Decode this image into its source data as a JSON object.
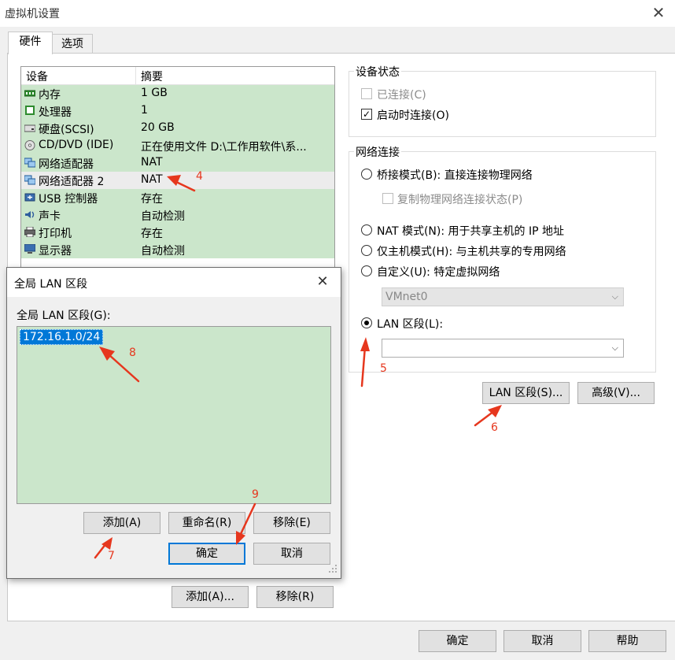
{
  "window": {
    "title": "虚拟机设置",
    "close_icon": "✕"
  },
  "tabs": [
    {
      "label": "硬件"
    },
    {
      "label": "选项"
    }
  ],
  "device_list": {
    "headers": {
      "device": "设备",
      "summary": "摘要"
    },
    "rows": [
      {
        "name": "内存",
        "summary": "1 GB",
        "icon": "memory-icon"
      },
      {
        "name": "处理器",
        "summary": "1",
        "icon": "processor-icon"
      },
      {
        "name": "硬盘(SCSI)",
        "summary": "20 GB",
        "icon": "hard-disk-icon"
      },
      {
        "name": "CD/DVD (IDE)",
        "summary": "正在使用文件 D:\\工作用软件\\系...",
        "icon": "cd-dvd-icon"
      },
      {
        "name": "网络适配器",
        "summary": "NAT",
        "icon": "network-adapter-icon"
      },
      {
        "name": "网络适配器 2",
        "summary": "NAT",
        "icon": "network-adapter-icon"
      },
      {
        "name": "USB 控制器",
        "summary": "存在",
        "icon": "usb-icon"
      },
      {
        "name": "声卡",
        "summary": "自动检测",
        "icon": "sound-card-icon"
      },
      {
        "name": "打印机",
        "summary": "存在",
        "icon": "printer-icon"
      },
      {
        "name": "显示器",
        "summary": "自动检测",
        "icon": "display-icon"
      }
    ],
    "selected_index": 5
  },
  "device_status": {
    "title": "设备状态",
    "connected": "已连接(C)",
    "connect_at_power_on": "启动时连接(O)",
    "connected_checked": false,
    "power_on_checked": true
  },
  "network": {
    "title": "网络连接",
    "bridged": "桥接模式(B): 直接连接物理网络",
    "replicate": "复制物理网络连接状态(P)",
    "nat": "NAT 模式(N): 用于共享主机的 IP 地址",
    "host_only": "仅主机模式(H): 与主机共享的专用网络",
    "custom": "自定义(U): 特定虚拟网络",
    "custom_value": "VMnet0",
    "lan_segment": "LAN 区段(L):",
    "lan_segment_value": "",
    "selected": "lan_segment"
  },
  "buttons": {
    "lan_segments": "LAN 区段(S)...",
    "advanced": "高级(V)...",
    "add": "添加(A)...",
    "remove": "移除(R)",
    "ok": "确定",
    "cancel": "取消",
    "help": "帮助"
  },
  "dialog": {
    "title": "全局 LAN 区段",
    "close_icon": "✕",
    "list_label": "全局 LAN 区段(G):",
    "segments": [
      "172.16.1.0/24"
    ],
    "buttons": {
      "add": "添加(A)",
      "rename": "重命名(R)",
      "remove": "移除(E)",
      "ok": "确定",
      "cancel": "取消"
    }
  },
  "annotations": {
    "accent_color": "#e6371e",
    "labels": [
      "4",
      "5",
      "6",
      "7",
      "8",
      "9"
    ]
  }
}
